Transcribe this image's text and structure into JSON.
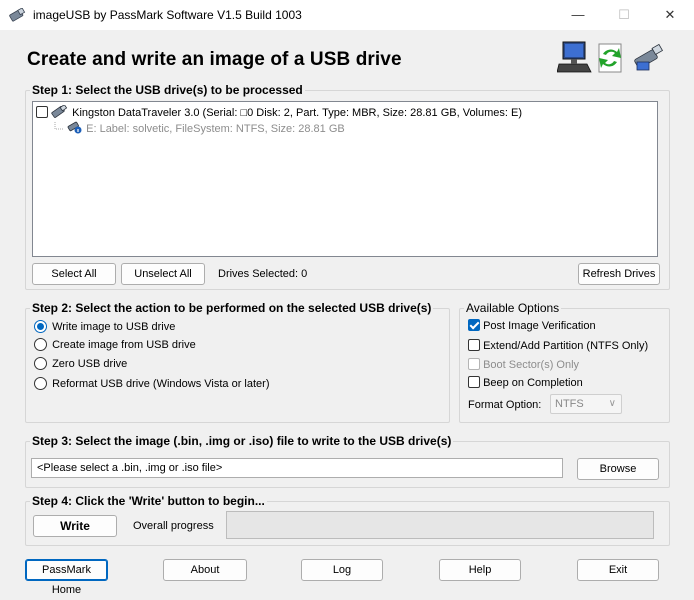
{
  "window": {
    "title": "imageUSB by PassMark Software V1.5 Build 1003",
    "minimize_glyph": "—",
    "maximize_glyph": "☐",
    "close_glyph": "✕"
  },
  "header": {
    "title": "Create and write an image of a USB drive",
    "icons": [
      "computer-icon",
      "refresh-arrows-icon",
      "usb-drive-icon"
    ]
  },
  "step1": {
    "label": "Step 1:  Select the USB drive(s) to be processed",
    "drive_checked": false,
    "drive_text": "Kingston DataTraveler 3.0 (Serial: □0 Disk: 2, Part. Type: MBR, Size: 28.81 GB, Volumes: E)",
    "volume_text": "E: Label: solvetic, FileSystem: NTFS, Size: 28.81 GB",
    "select_all": "Select All",
    "unselect_all": "Unselect All",
    "drives_selected": "Drives Selected: 0",
    "refresh": "Refresh Drives"
  },
  "step2": {
    "label": "Step 2: Select the action to be performed on the selected USB drive(s)",
    "selected": 0,
    "actions": [
      "Write image to USB drive",
      "Create image from USB drive",
      "Zero USB drive",
      "Reformat USB drive (Windows Vista or later)"
    ]
  },
  "options": {
    "label": "Available Options",
    "items": [
      {
        "label": "Post Image Verification",
        "checked": true,
        "enabled": true
      },
      {
        "label": "Extend/Add Partition (NTFS Only)",
        "checked": false,
        "enabled": true
      },
      {
        "label": "Boot Sector(s) Only",
        "checked": false,
        "enabled": false
      },
      {
        "label": "Beep on Completion",
        "checked": false,
        "enabled": true
      }
    ],
    "format_label": "Format Option:",
    "format_value": "NTFS"
  },
  "step3": {
    "label": "Step 3: Select the image (.bin, .img or .iso) file to write to the USB drive(s)",
    "file_value": "<Please select a .bin, .img or .iso file>",
    "browse": "Browse"
  },
  "step4": {
    "label": "Step 4: Click the 'Write' button to begin...",
    "action_button": "Write",
    "progress_label": "Overall progress",
    "progress": 0
  },
  "footer": {
    "home": "PassMark Home",
    "about": "About",
    "log": "Log",
    "help": "Help",
    "exit": "Exit"
  },
  "colors": {
    "accent": "#0067c0",
    "window_bg": "#f0f0f0"
  }
}
